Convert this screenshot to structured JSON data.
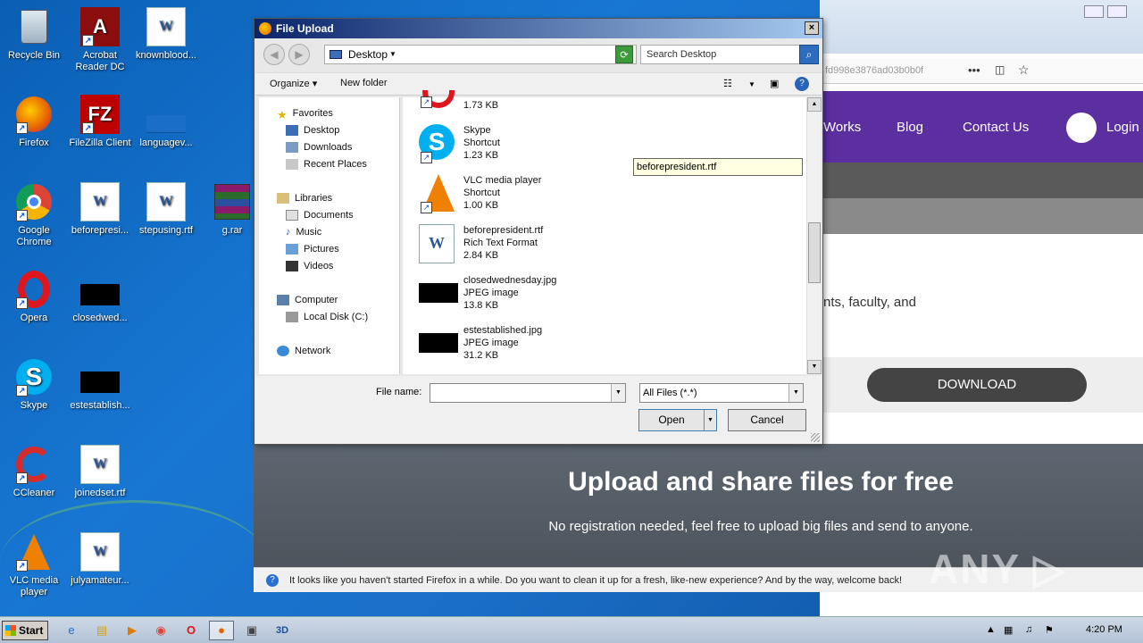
{
  "desktop": {
    "icons": [
      {
        "label": "Recycle Bin",
        "icon": "recycle-bin-icon"
      },
      {
        "label": "Acrobat Reader DC",
        "icon": "acrobat-icon"
      },
      {
        "label": "knownblood...",
        "icon": "word-doc-icon"
      },
      {
        "label": "Firefox",
        "icon": "firefox-icon"
      },
      {
        "label": "FileZilla Client",
        "icon": "filezilla-icon"
      },
      {
        "label": "languagev...",
        "icon": "blue-file-icon"
      },
      {
        "label": "Google Chrome",
        "icon": "chrome-icon"
      },
      {
        "label": "beforepresi...",
        "icon": "word-doc-icon"
      },
      {
        "label": "stepusing.rtf",
        "icon": "word-doc-icon"
      },
      {
        "label": "g.rar",
        "icon": "winrar-icon"
      },
      {
        "label": "Opera",
        "icon": "opera-icon"
      },
      {
        "label": "closedwed...",
        "icon": "black-image-icon"
      },
      {
        "label": "Skype",
        "icon": "skype-icon"
      },
      {
        "label": "estestablish...",
        "icon": "black-image-icon"
      },
      {
        "label": "CCleaner",
        "icon": "ccleaner-icon"
      },
      {
        "label": "joinedset.rtf",
        "icon": "word-doc-icon"
      },
      {
        "label": "VLC media player",
        "icon": "vlc-icon"
      },
      {
        "label": "julyamateur...",
        "icon": "word-doc-icon"
      }
    ]
  },
  "browser": {
    "url_fragment": "fd998e3876ad03b0b0f",
    "nav": [
      "Works",
      "Blog",
      "Contact Us",
      "Login"
    ],
    "body_text": "nts, faculty, and",
    "download_label": "DOWNLOAD",
    "hero_title": "Upload and share files for free",
    "hero_sub": "No registration needed, feel free to upload big files and send to anyone.",
    "notification": "It looks like you haven't started Firefox in a while. Do you want to clean it up for a fresh, like-new experience? And by the way, welcome back!",
    "watermark": "ANY ▷ RUN"
  },
  "dialog": {
    "title": "File Upload",
    "close": "×",
    "location": "Desktop",
    "search_placeholder": "Search Desktop",
    "toolbar": {
      "organize": "Organize",
      "new_folder": "New folder"
    },
    "nav": {
      "favorites": "Favorites",
      "desktop": "Desktop",
      "downloads": "Downloads",
      "recent": "Recent Places",
      "libraries": "Libraries",
      "documents": "Documents",
      "music": "Music",
      "pictures": "Pictures",
      "videos": "Videos",
      "computer": "Computer",
      "local_disk": "Local Disk (C:)",
      "network": "Network"
    },
    "files": [
      {
        "name": "",
        "type": "",
        "size": "1.73 KB"
      },
      {
        "name": "Skype",
        "type": "Shortcut",
        "size": "1.23 KB"
      },
      {
        "name": "VLC media player",
        "type": "Shortcut",
        "size": "1.00 KB"
      },
      {
        "name": "beforepresident.rtf",
        "type": "Rich Text Format",
        "size": "2.84 KB"
      },
      {
        "name": "closedwednesday.jpg",
        "type": "JPEG image",
        "size": "13.8 KB"
      },
      {
        "name": "estestablished.jpg",
        "type": "JPEG image",
        "size": "31.2 KB"
      }
    ],
    "tooltip": "beforepresident.rtf",
    "file_name_label": "File name:",
    "file_name_value": "",
    "file_type": "All Files (*.*)",
    "open_label": "Open",
    "cancel_label": "Cancel"
  },
  "taskbar": {
    "start": "Start",
    "clock": "4:20 PM"
  }
}
